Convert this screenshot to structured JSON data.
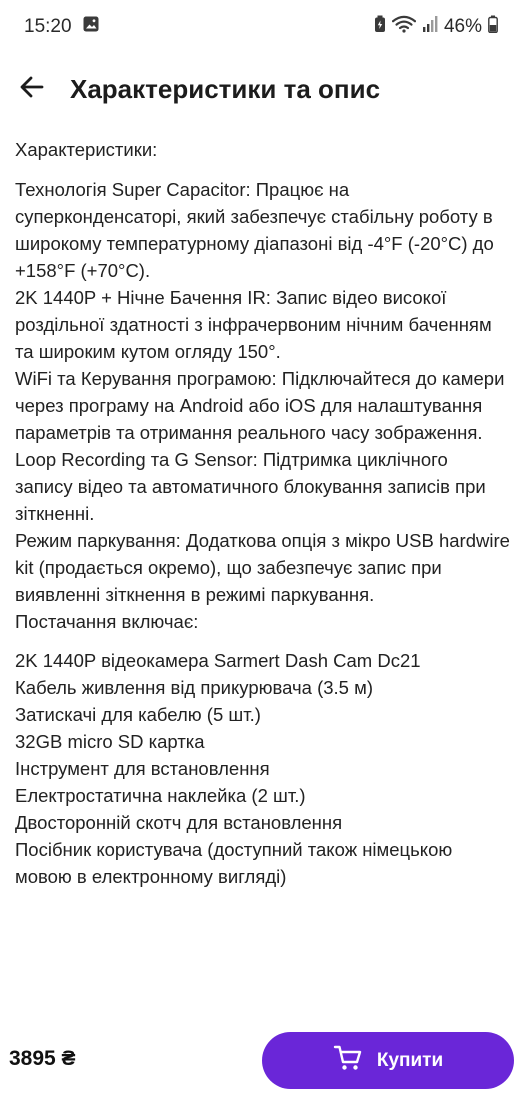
{
  "status_bar": {
    "time": "15:20",
    "battery": "46%",
    "icons": [
      "gallery-icon",
      "battery-saver-icon",
      "wifi-icon",
      "signal-icon",
      "battery-icon"
    ]
  },
  "header": {
    "title": "Характеристики та опис",
    "back_icon": "arrow-left-icon"
  },
  "description": {
    "specs_heading": "Характеристики:",
    "features": [
      "Технологія Super Capacitor: Працює на суперконденсаторі, який забезпечує стабільну роботу в широкому температурному діапазоні від -4°F (-20°C) до +158°F (+70°C).",
      "2K 1440P + Нічне Бачення IR: Запис відео високої роздільної здатності з інфрачервоним нічним баченням та широким кутом огляду 150°.",
      "WiFi та Керування програмою: Підключайтеся до камери через програму на Android або iOS для налаштування параметрів та отримання реального часу зображення.",
      "Loop Recording та G Sensor: Підтримка циклічного запису відео та автоматичного блокування записів при зіткненні.",
      "Режим паркування: Додаткова опція з мікро USB hardwire kit (продається окремо), що забезпечує запис при виявленні зіткнення в режимі паркування."
    ],
    "supply_heading": "Постачання включає:",
    "supply_items": [
      "2K 1440P відеокамера Sarmert Dash Cam Dc21",
      "Кабель живлення від прикурювача (3.5 м)",
      "Затискачі для кабелю (5 шт.)",
      "32GB micro SD картка",
      "Інструмент для встановлення",
      "Електростатична наклейка (2 шт.)",
      "Двосторонній скотч для встановлення",
      "Посібник користувача (доступний також німецькою мовою в електронному вигляді)"
    ]
  },
  "bottom_bar": {
    "price": "3895 ₴",
    "buy_label": "Купити",
    "buy_icon": "cart-icon"
  },
  "colors": {
    "accent": "#6a26d8",
    "text": "#222222",
    "background": "#ffffff"
  }
}
